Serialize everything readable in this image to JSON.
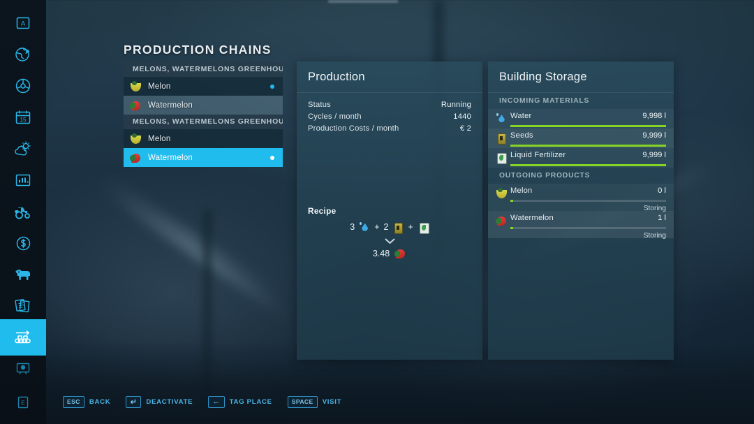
{
  "sidebar": {
    "items": [
      {
        "name": "map-overview-icon",
        "icon": "letter-a-box"
      },
      {
        "name": "globe-icon",
        "icon": "globe"
      },
      {
        "name": "steering-wheel-icon",
        "icon": "steering-wheel"
      },
      {
        "name": "calendar-icon",
        "icon": "calendar-15",
        "badge": "15"
      },
      {
        "name": "weather-icon",
        "icon": "cloud-sun"
      },
      {
        "name": "statistics-icon",
        "icon": "bar-chart"
      },
      {
        "name": "vehicles-icon",
        "icon": "tractor"
      },
      {
        "name": "finances-icon",
        "icon": "dollar-coin"
      },
      {
        "name": "animals-icon",
        "icon": "cow"
      },
      {
        "name": "contracts-icon",
        "icon": "documents"
      },
      {
        "name": "production-icon",
        "icon": "conveyor",
        "active": true
      },
      {
        "name": "radio-icon",
        "icon": "radio"
      },
      {
        "name": "exit-icon",
        "icon": "letter-e-box"
      }
    ]
  },
  "header": {
    "title": "PRODUCTION CHAINS"
  },
  "chain_list": {
    "groups": [
      {
        "label": "MELONS, WATERMELONS GREENHOUSE",
        "items": [
          {
            "label": "Melon",
            "icon": "melon-icon",
            "state": "dark",
            "has_dot": true
          },
          {
            "label": "Watermelon",
            "icon": "watermelon-icon",
            "state": "hover",
            "has_dot": false
          }
        ]
      },
      {
        "label": "MELONS, WATERMELONS GREENHOUSE",
        "items": [
          {
            "label": "Melon",
            "icon": "melon-icon",
            "state": "dark",
            "has_dot": false
          },
          {
            "label": "Watermelon",
            "icon": "watermelon-icon",
            "state": "selected",
            "has_dot": true
          }
        ]
      }
    ]
  },
  "production": {
    "title": "Production",
    "stats": [
      {
        "label": "Status",
        "value": "Running"
      },
      {
        "label": "Cycles / month",
        "value": "1440"
      },
      {
        "label": "Production Costs / month",
        "value": "€ 2"
      }
    ],
    "recipe_label": "Recipe",
    "recipe": {
      "inputs": [
        {
          "amount": "3",
          "icon": "water-icon"
        },
        {
          "amount": "2",
          "icon": "seeds-icon"
        },
        {
          "amount": "",
          "icon": "liquid-fertilizer-icon"
        }
      ],
      "plus": "+",
      "output": {
        "amount": "3.48",
        "icon": "watermelon-icon"
      }
    }
  },
  "storage": {
    "title": "Building Storage",
    "incoming_header": "INCOMING MATERIALS",
    "incoming": [
      {
        "label": "Water",
        "icon": "water-icon",
        "value": "9,998 l",
        "fill": 100
      },
      {
        "label": "Seeds",
        "icon": "seeds-icon",
        "value": "9,999 l",
        "fill": 100
      },
      {
        "label": "Liquid Fertilizer",
        "icon": "liquid-fertilizer-icon",
        "value": "9,999 l",
        "fill": 100
      }
    ],
    "outgoing_header": "OUTGOING PRODUCTS",
    "outgoing": [
      {
        "label": "Melon",
        "icon": "melon-icon",
        "value": "0 l",
        "fill": 2,
        "status": "Storing"
      },
      {
        "label": "Watermelon",
        "icon": "watermelon-icon",
        "value": "1 l",
        "fill": 2,
        "status": "Storing"
      }
    ]
  },
  "help_bar": {
    "items": [
      {
        "key": "ESC",
        "glyph": false,
        "label": "BACK"
      },
      {
        "key": "↵",
        "glyph": true,
        "label": "DEACTIVATE"
      },
      {
        "key": "←",
        "glyph": true,
        "label": "TAG PLACE"
      },
      {
        "key": "SPACE",
        "glyph": false,
        "label": "VISIT"
      }
    ]
  },
  "colors": {
    "accent": "#1fbced",
    "bar_green": "#86d426",
    "panel_bg": "#2a4b5c",
    "help_text": "#49b7e8"
  }
}
